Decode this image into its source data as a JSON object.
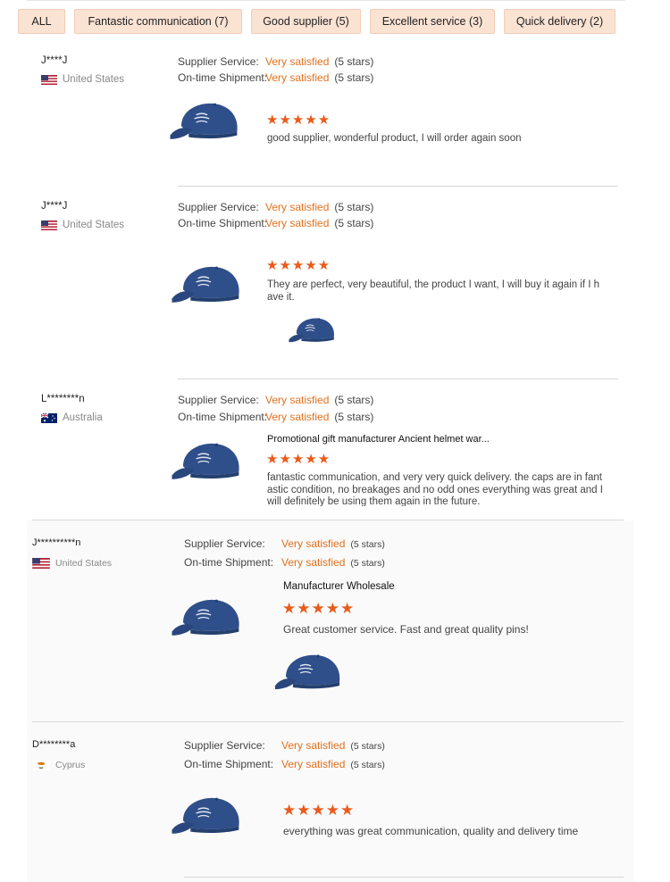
{
  "filters": [
    {
      "label": "ALL"
    },
    {
      "label": "Fantastic communication (7)"
    },
    {
      "label": "Good supplier (5)"
    },
    {
      "label": "Excellent service (3)"
    },
    {
      "label": "Quick delivery (2)"
    }
  ],
  "labels": {
    "supplier_service": "Supplier Service:",
    "ontime_shipment": "On-time Shipment:"
  },
  "colors": {
    "accent": "#e0711e",
    "star": "#ea5a1a",
    "chip_bg": "#fbe3d4",
    "cap": "#2f4f8a"
  },
  "reviews": [
    {
      "user": "J****J",
      "country": "United States",
      "flag": "us-flag",
      "supplier_service": "Very satisfied",
      "supplier_stars": "(5 stars)",
      "shipment": "Very satisfied",
      "shipment_stars": "(5 stars)",
      "rating": 5,
      "product_title": "",
      "comment": "good supplier, wonderful product, I will order again soon"
    },
    {
      "user": "J****J",
      "country": "United States",
      "flag": "us-flag",
      "supplier_service": "Very satisfied",
      "supplier_stars": "(5 stars)",
      "shipment": "Very satisfied",
      "shipment_stars": "(5 stars)",
      "rating": 5,
      "product_title": "",
      "comment": "They are perfect, very beautiful, the product I want, I will buy it again if I have it."
    },
    {
      "user": "L********n",
      "country": "Australia",
      "flag": "au-flag",
      "supplier_service": "Very satisfied",
      "supplier_stars": "(5 stars)",
      "shipment": "Very satisfied",
      "shipment_stars": "(5 stars)",
      "rating": 5,
      "product_title": "Promotional gift manufacturer Ancient helmet war...",
      "comment": "fantastic communication, and very very quick delivery. the caps are in fantastic condition, no breakages and no odd ones everything was great and I will definitely be using them again in the future."
    },
    {
      "user": "J**********n",
      "country": "United States",
      "flag": "us-flag",
      "supplier_service": "Very satisfied",
      "supplier_stars": "(5 stars)",
      "shipment": "Very satisfied",
      "shipment_stars": "(5 stars)",
      "rating": 5,
      "product_title": "Manufacturer Wholesale",
      "comment": "Great customer service.  Fast and great quality pins!"
    },
    {
      "user": "D********a",
      "country": "Cyprus",
      "flag": "cy-flag",
      "supplier_service": "Very satisfied",
      "supplier_stars": "(5 stars)",
      "shipment": "Very satisfied",
      "shipment_stars": "(5 stars)",
      "rating": 5,
      "product_title": "",
      "comment": "everything was great communication, quality and delivery time"
    }
  ]
}
